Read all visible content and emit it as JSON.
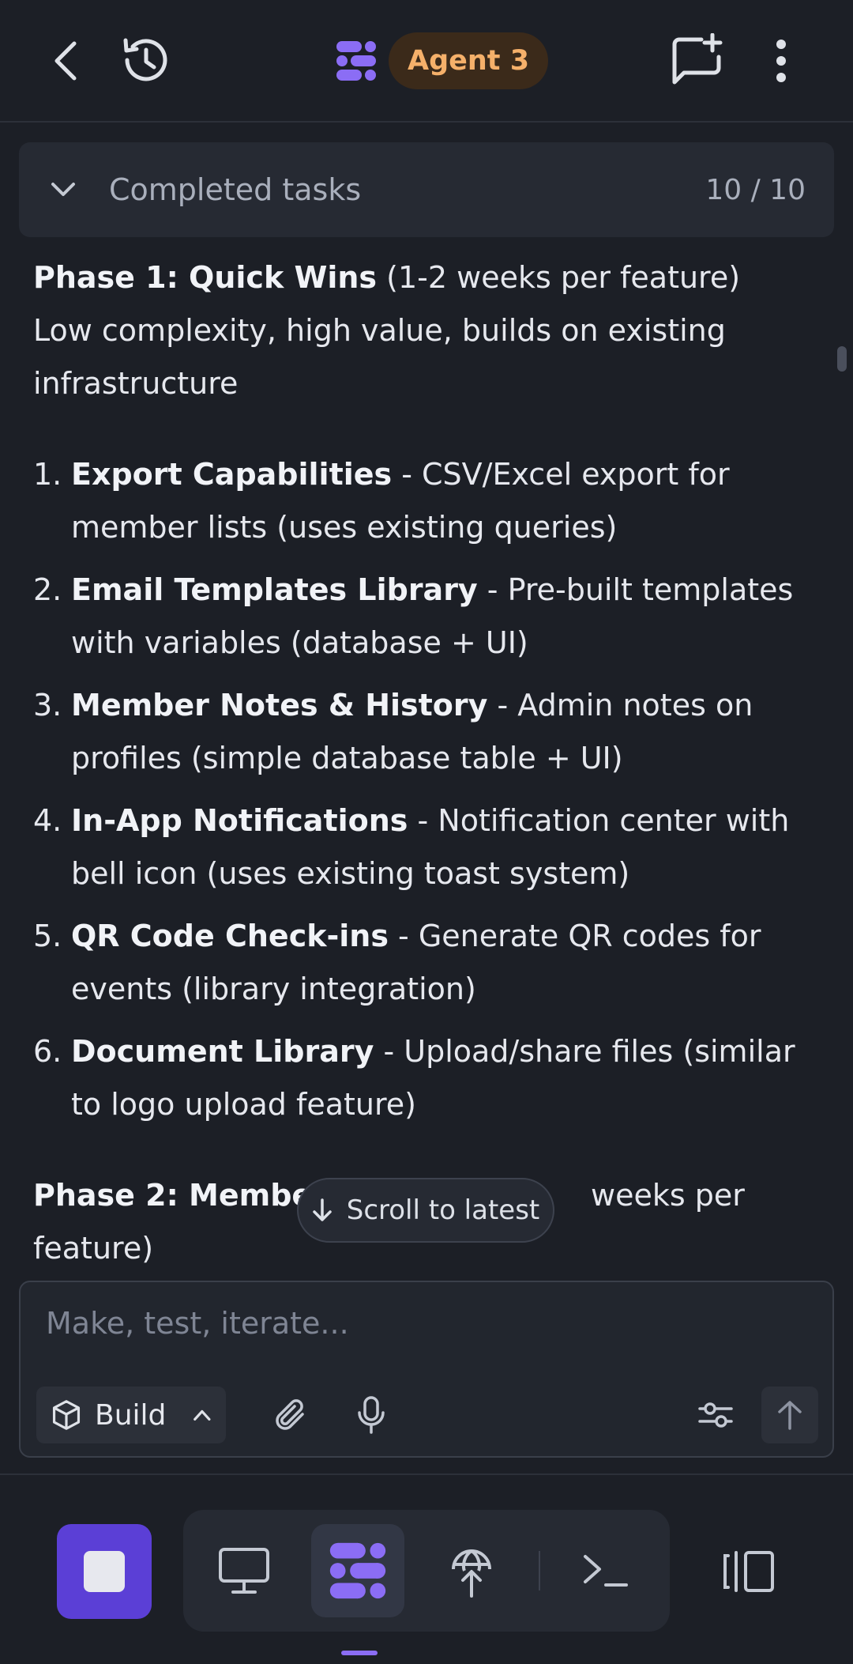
{
  "header": {
    "agent_label": "Agent 3"
  },
  "tasks": {
    "label": "Completed tasks",
    "count": "10 / 10"
  },
  "content": {
    "phase1_title": "Phase 1: Quick Wins",
    "phase1_suffix": " (1-2 weeks per feature)",
    "phase1_desc": "Low complexity, high value, builds on existing infrastructure",
    "items": [
      {
        "num": "1.",
        "title": "Export Capabilities",
        "desc": " - CSV/Excel export for member lists (uses existing queries)"
      },
      {
        "num": "2.",
        "title": "Email Templates Library",
        "desc": " - Pre-built templates with variables (database + UI)"
      },
      {
        "num": "3.",
        "title": "Member Notes & History",
        "desc": " - Admin notes on profiles (simple database table + UI)"
      },
      {
        "num": "4.",
        "title": "In-App Notifications",
        "desc": " - Notification center with bell icon (uses existing toast system)"
      },
      {
        "num": "5.",
        "title": "QR Code Check-ins",
        "desc": " - Generate QR codes for events (library integration)"
      },
      {
        "num": "6.",
        "title": "Document Library",
        "desc": " - Upload/share files (similar to logo upload feature)"
      }
    ],
    "phase2_title": "Phase 2: Member",
    "phase2_suffix": " weeks per feature)"
  },
  "scroll_latest": "Scroll to latest",
  "composer": {
    "placeholder": "Make, test, iterate...",
    "build_label": "Build"
  },
  "colors": {
    "accent": "#5b3fd6",
    "agent_badge_bg": "#3b2a1a",
    "agent_badge_text": "#f5b06a",
    "background": "#1c1f26"
  }
}
